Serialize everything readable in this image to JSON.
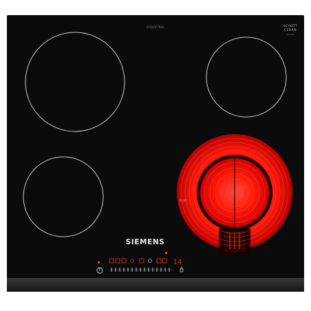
{
  "hob": {
    "brand": "SIEMENS",
    "top_code": "ET645FFN1E",
    "schott_line1": "SCHOTT",
    "schott_line2": "CERAN",
    "schott_line3": "ceramic",
    "zone_label": "Bratfl.",
    "display_value": "14",
    "power_icon": "power-icon",
    "lock_icon": "lock-icon",
    "heating_color": "#ff1a0a",
    "glass_color": "#0b0b0b",
    "frame_color": "#2a2a2a",
    "ring_color": "#cfcfcf"
  }
}
